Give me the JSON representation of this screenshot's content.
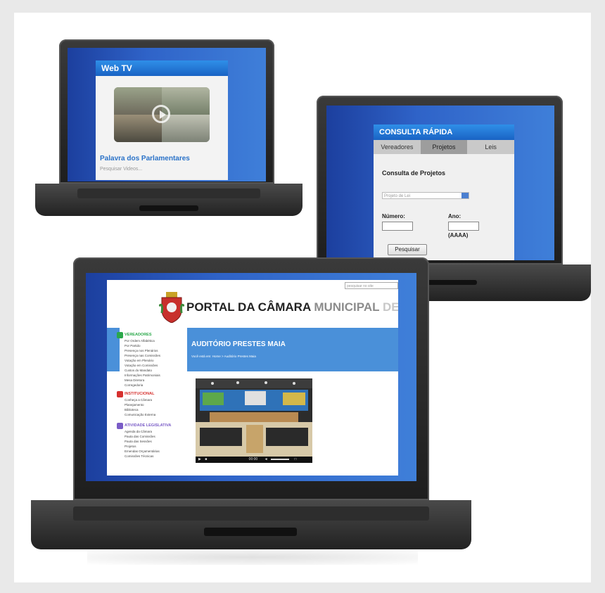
{
  "webtv": {
    "title": "Web TV",
    "caption": "Palavra dos Parlamentares",
    "sub_link": "Pesquisar Videos..."
  },
  "consulta": {
    "header": "CONSULTA RÁPIDA",
    "tabs": [
      "Vereadores",
      "Projetos",
      "Leis"
    ],
    "active_tab": "Projetos",
    "section_title": "Consulta de Projetos",
    "select_value": "Projeto de Lei",
    "numero_label": "Número:",
    "ano_label": "Ano:",
    "ano_format": "(AAAA)",
    "button_label": "Pesquisar"
  },
  "portal": {
    "search_placeholder": "pesquisar no site",
    "title_part1": "PORTAL DA CÂMARA",
    "title_part2": "MUNICIPAL",
    "title_part3": "DE SÃ",
    "banner_title": "AUDITÓRIO PRESTES MAIA",
    "breadcrumb": "Você está em: Home > Auditório Prestes Maia",
    "video_time": "00:00",
    "sections": [
      {
        "title": "VEREADORES",
        "color": "#2aa84a",
        "items": [
          "Por Ordem Alfabética",
          "Por Partido",
          "Presença nos Plenários",
          "Presença nas Comissões",
          "Votação em Plenário",
          "Votação em Comissões",
          "Custos do Mandato",
          "Informações Patrimoniais",
          "Mesa Diretora",
          "Corregedoria"
        ]
      },
      {
        "title": "INSTITUCIONAL",
        "color": "#d6302e",
        "items": [
          "Conheça a Câmara",
          "Planejamento",
          "Biblioteca",
          "Comunicação Externa"
        ]
      },
      {
        "title": "ATIVIDADE LEGISLATIVA",
        "color": "#7a5cc7",
        "items": [
          "Agenda da Câmara",
          "Pauta das Comissões",
          "Pauta das Sessões",
          "Projetos",
          "Emendas Orçamentárias",
          "Comissões Técnicas"
        ]
      }
    ]
  },
  "colors": {
    "accent_blue": "#4a90d9",
    "header_blue": "#1a63c4",
    "screen_blue": "#2f63c8",
    "laptop_body": "#2a2a2a"
  }
}
